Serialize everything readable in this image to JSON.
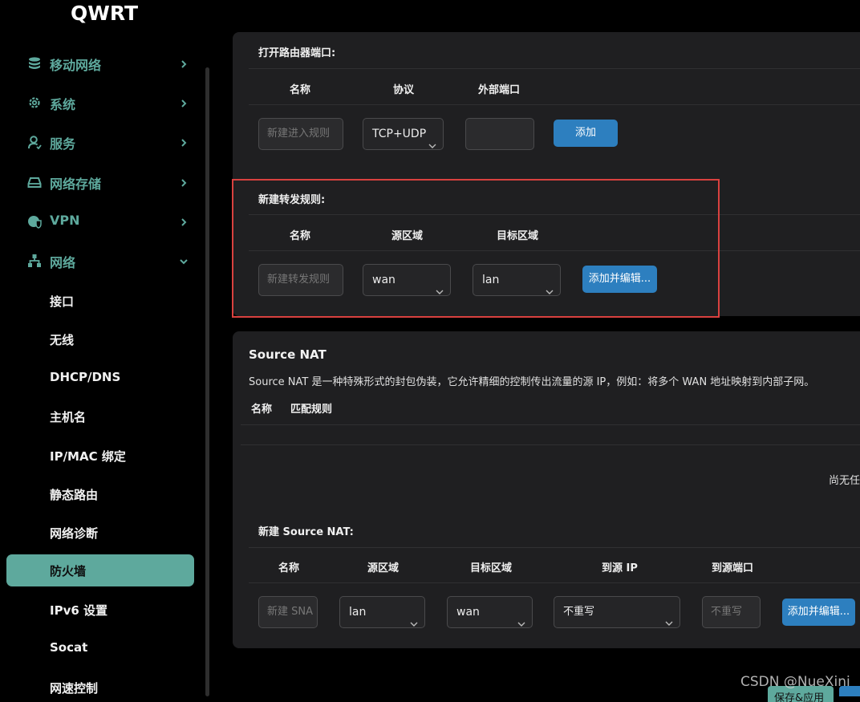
{
  "app": {
    "title": "QWRT"
  },
  "sidebar": {
    "items": [
      {
        "label": "移动网络",
        "icon": "database-icon"
      },
      {
        "label": "系统",
        "icon": "gear-icon"
      },
      {
        "label": "服务",
        "icon": "user-icon"
      },
      {
        "label": "网络存储",
        "icon": "drive-icon"
      },
      {
        "label": "VPN",
        "icon": "globe-shield-icon"
      },
      {
        "label": "网络",
        "icon": "network-icon",
        "expanded": true
      }
    ],
    "sub_items": [
      {
        "label": "接口"
      },
      {
        "label": "无线"
      },
      {
        "label": "DHCP/DNS"
      },
      {
        "label": "主机名"
      },
      {
        "label": "IP/MAC 绑定"
      },
      {
        "label": "静态路由"
      },
      {
        "label": "网络诊断"
      },
      {
        "label": "防火墙",
        "active": true
      },
      {
        "label": "IPv6 设置"
      },
      {
        "label": "Socat"
      },
      {
        "label": "网速控制"
      }
    ],
    "accent_color": "#5ea99d"
  },
  "port_open": {
    "title": "打开路由器端口:",
    "headers": [
      "名称",
      "协议",
      "外部端口"
    ],
    "name_placeholder": "新建进入规则",
    "protocol_value": "TCP+UDP",
    "port_value": "",
    "add_label": "添加"
  },
  "forward": {
    "title": "新建转发规则:",
    "headers": [
      "名称",
      "源区域",
      "目标区域"
    ],
    "name_placeholder": "新建转发规则",
    "src_zone": "wan",
    "dest_zone": "lan",
    "add_edit_label": "添加并编辑..."
  },
  "snat": {
    "title": "Source NAT",
    "description": "Source NAT 是一种特殊形式的封包伪装，它允许精细的控制传出流量的源 IP，例如：将多个 WAN 地址映射到内部子网。",
    "table_headers": [
      "名称",
      "匹配规则"
    ],
    "empty_text": "尚无任",
    "new_title": "新建 Source NAT:",
    "new_headers": [
      "名称",
      "源区域",
      "目标区域",
      "到源 IP",
      "到源端口"
    ],
    "name_placeholder": "新建 SNA",
    "src_zone": "lan",
    "dest_zone": "wan",
    "to_ip": "不重写",
    "to_port_placeholder": "不重写",
    "add_edit_label": "添加并编辑..."
  },
  "footer": {
    "save_apply_label": "保存&应用",
    "watermark": "CSDN @NueXini"
  },
  "colors": {
    "button_blue": "#2d7fbf",
    "highlight_red": "#d9413f",
    "panel": "#1f1f21"
  }
}
